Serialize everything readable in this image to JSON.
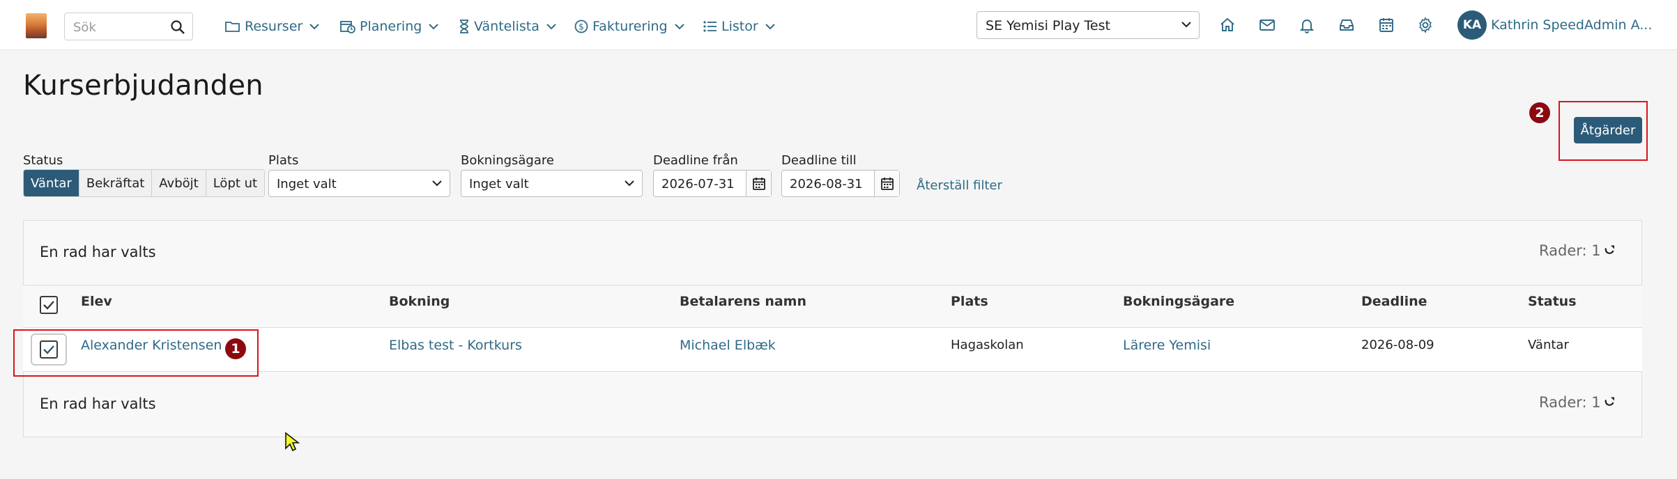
{
  "nav": {
    "search_placeholder": "Sök",
    "items": [
      {
        "label": "Resurser",
        "icon": "folder-icon"
      },
      {
        "label": "Planering",
        "icon": "calendar-clock-icon"
      },
      {
        "label": "Väntelista",
        "icon": "hourglass-icon"
      },
      {
        "label": "Fakturering",
        "icon": "dollar-circle-icon"
      },
      {
        "label": "Listor",
        "icon": "list-icon"
      }
    ],
    "school": "SE Yemisi Play Test",
    "user_initials": "KA",
    "user_name": "Kathrin SpeedAdmin A..."
  },
  "page": {
    "title": "Kurserbjudanden",
    "actions_label": "Åtgärder"
  },
  "markers": {
    "one": "1",
    "two": "2"
  },
  "filters": {
    "status_label": "Status",
    "status_options": [
      "Väntar",
      "Bekräftat",
      "Avböjt",
      "Löpt ut"
    ],
    "status_selected": "Väntar",
    "place_label": "Plats",
    "place_value": "Inget valt",
    "owner_label": "Bokningsägare",
    "owner_value": "Inget valt",
    "deadline_from_label": "Deadline från",
    "deadline_from_value": "2026-07-31",
    "deadline_to_label": "Deadline till",
    "deadline_to_value": "2026-08-31",
    "reset_label": "Återställ filter"
  },
  "table": {
    "selection_text": "En rad har valts",
    "rows_label": "Rader: 1",
    "columns": [
      "Elev",
      "Bokning",
      "Betalarens namn",
      "Plats",
      "Bokningsägare",
      "Deadline",
      "Status"
    ],
    "rows": [
      {
        "student": "Alexander Kristensen",
        "booking": "Elbas test - Kortkurs",
        "payer": "Michael Elbæk",
        "place": "Hagaskolan",
        "owner": "Lärere Yemisi",
        "deadline": "2026-08-09",
        "status": "Väntar"
      }
    ]
  },
  "colors": {
    "primary": "#2b5b78",
    "link": "#2f6a86",
    "highlight": "#d9141c",
    "marker": "#8b0a0f"
  }
}
